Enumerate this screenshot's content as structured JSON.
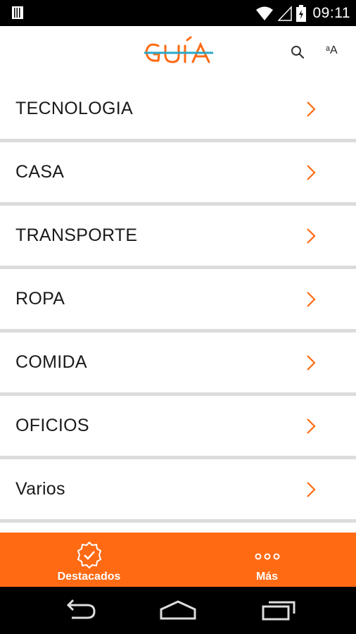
{
  "status_bar": {
    "time": "09:11",
    "icons": [
      "notification-icon",
      "wifi-icon",
      "signal-icon",
      "battery-icon"
    ]
  },
  "app_bar": {
    "logo_text": "GUÍA",
    "actions": [
      "search-icon",
      "font-size-icon"
    ],
    "font_action_label": "ᵃA"
  },
  "categories": [
    {
      "label": "TECNOLOGIA"
    },
    {
      "label": "CASA"
    },
    {
      "label": "TRANSPORTE"
    },
    {
      "label": "ROPA"
    },
    {
      "label": "COMIDA"
    },
    {
      "label": "OFICIOS"
    },
    {
      "label": "Varios"
    }
  ],
  "bottom_nav": {
    "tabs": [
      {
        "label": "Destacados",
        "icon": "badge-check-icon"
      },
      {
        "label": "Más",
        "icon": "more-dots-icon"
      }
    ]
  },
  "system_nav": [
    "back-icon",
    "home-icon",
    "recents-icon"
  ],
  "colors": {
    "accent": "#ff6a13",
    "logo_teal": "#2aa8c9",
    "divider": "#dcdcdc"
  }
}
